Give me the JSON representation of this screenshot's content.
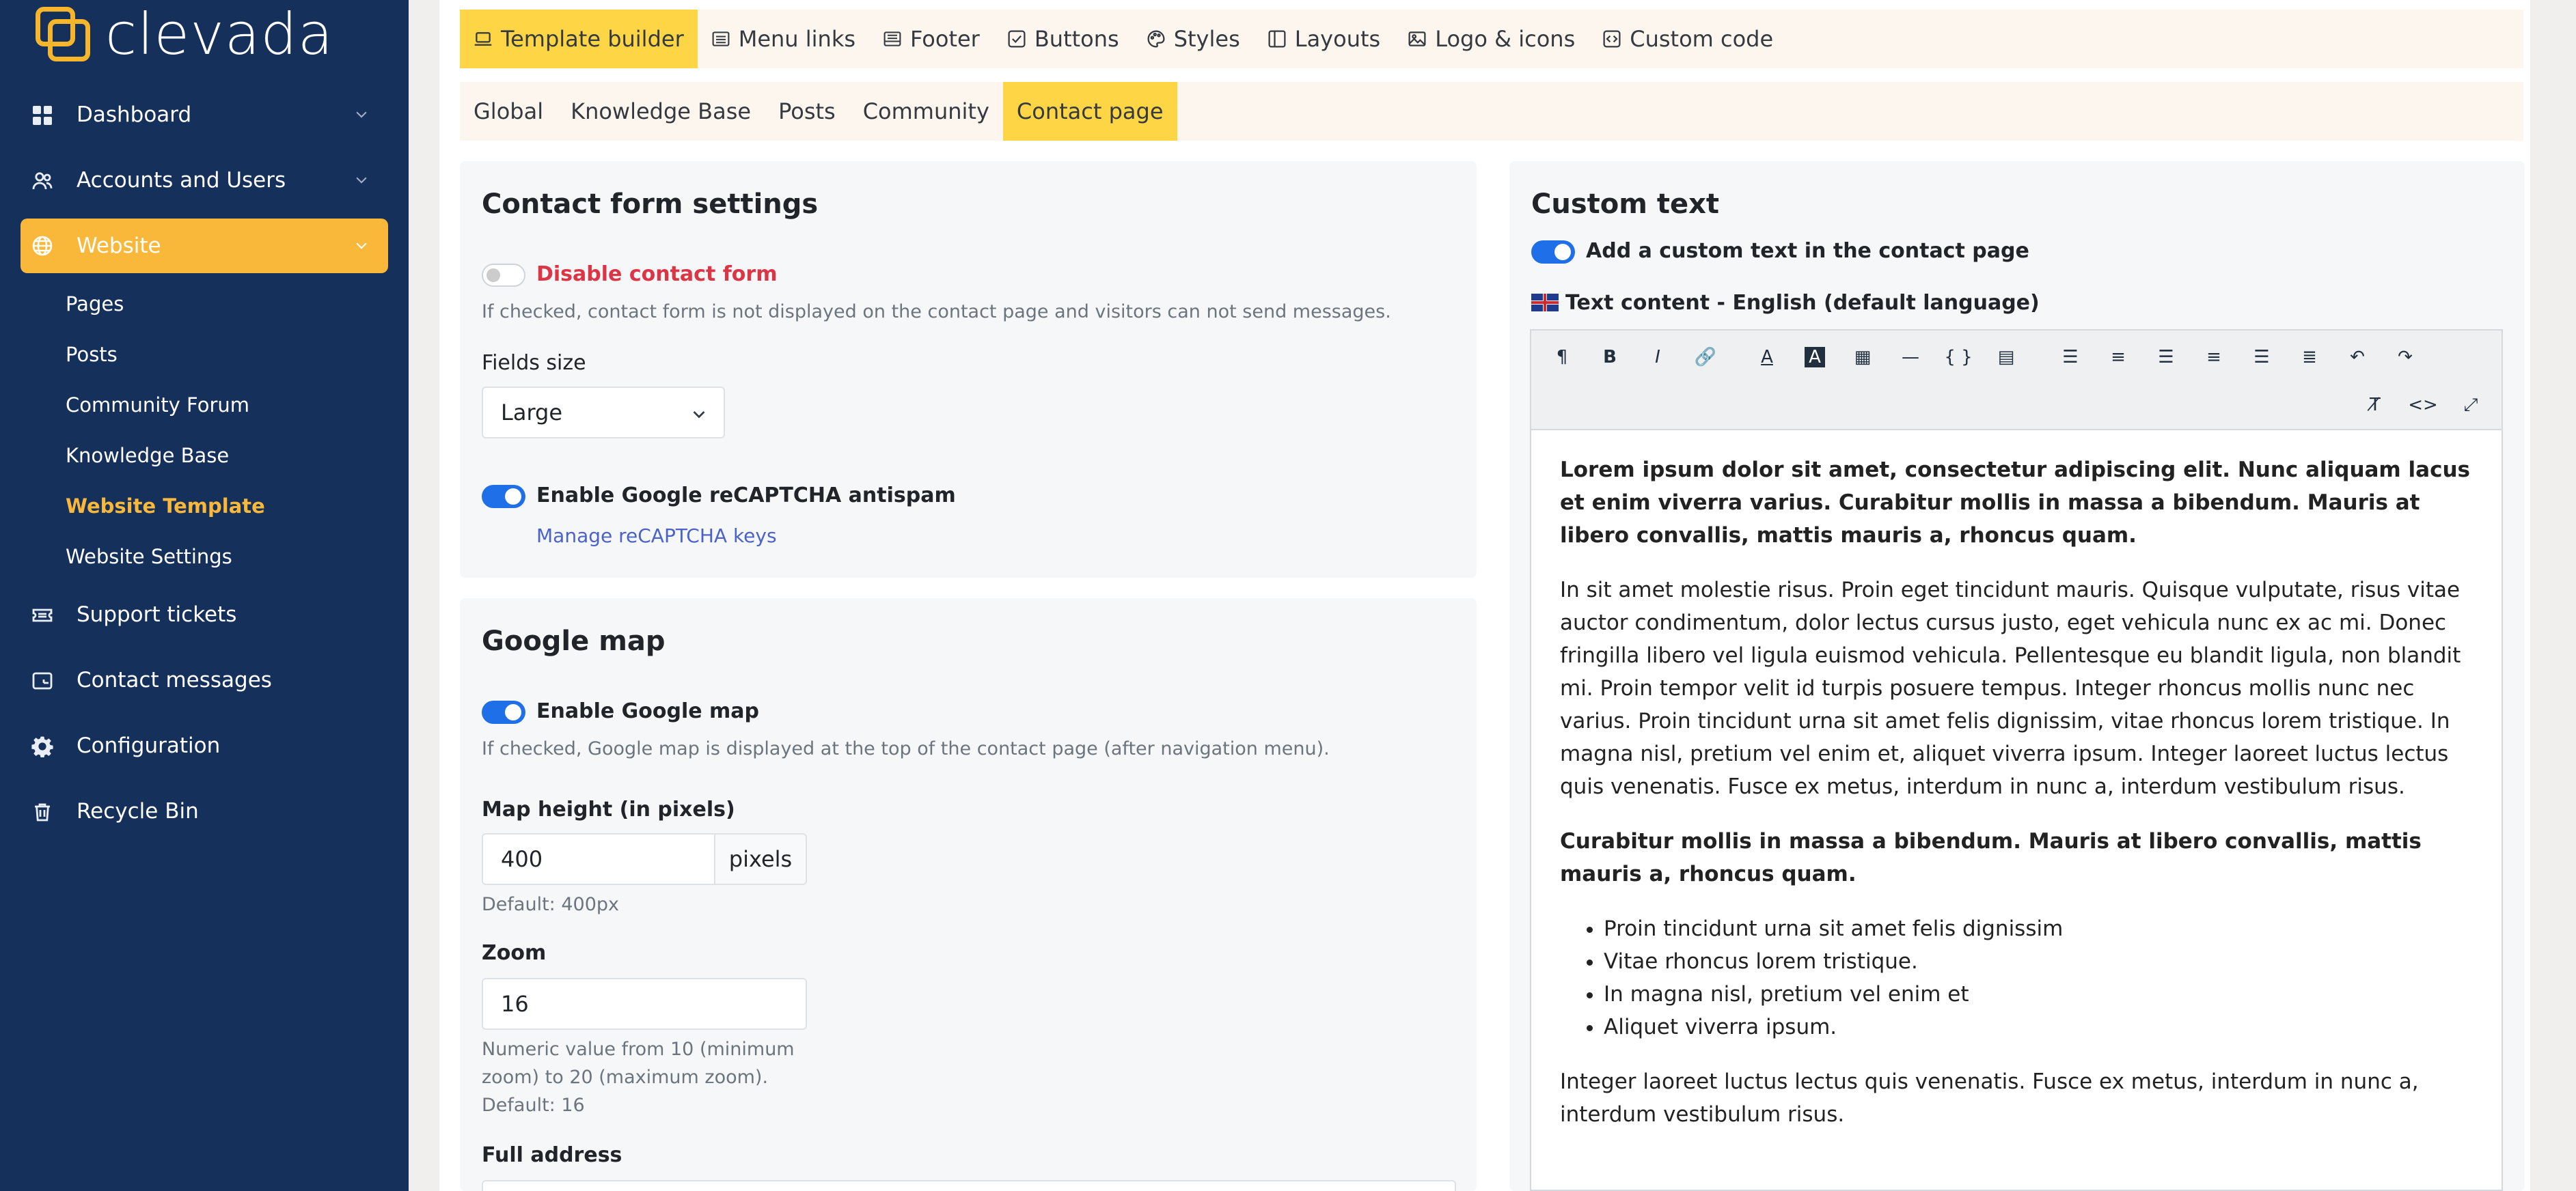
{
  "brand": {
    "name": "clevada",
    "accent": "#f9b839",
    "sidebar_bg": "#15305a"
  },
  "sidebar": {
    "items": [
      {
        "label": "Dashboard",
        "icon": "grid-icon"
      },
      {
        "label": "Accounts and Users",
        "icon": "users-icon"
      },
      {
        "label": "Website",
        "icon": "globe-icon"
      },
      {
        "label": "Support tickets",
        "icon": "ticket-icon"
      },
      {
        "label": "Contact messages",
        "icon": "inbox-icon"
      },
      {
        "label": "Configuration",
        "icon": "gear-icon"
      },
      {
        "label": "Recycle Bin",
        "icon": "trash-icon"
      }
    ],
    "website_sub": [
      "Pages",
      "Posts",
      "Community Forum",
      "Knowledge Base",
      "Website Template",
      "Website Settings"
    ]
  },
  "tabs": [
    "Template builder",
    "Menu links",
    "Footer",
    "Buttons",
    "Styles",
    "Layouts",
    "Logo & icons",
    "Custom code"
  ],
  "subtabs": [
    "Global",
    "Knowledge Base",
    "Posts",
    "Community",
    "Contact page"
  ],
  "contact_form": {
    "title": "Contact form settings",
    "disable_label": "Disable contact form",
    "disable_help": "If checked, contact form is not displayed on the contact page and visitors can not send messages.",
    "fields_size_label": "Fields size",
    "fields_size_value": "Large",
    "recaptcha_label": "Enable Google reCAPTCHA antispam",
    "recaptcha_link": "Manage reCAPTCHA keys"
  },
  "google_map": {
    "title": "Google map",
    "enable_label": "Enable Google map",
    "enable_help": "If checked, Google map is displayed at the top of the contact page (after navigation menu).",
    "height_label": "Map height (in pixels)",
    "height_value": "400",
    "height_unit": "pixels",
    "height_default": "Default: 400px",
    "zoom_label": "Zoom",
    "zoom_value": "16",
    "zoom_help_1": "Numeric value from 10 (minimum",
    "zoom_help_2": "zoom) to 20 (maximum zoom).",
    "zoom_help_3": "Default: 16",
    "address_label": "Full address"
  },
  "custom_text": {
    "title": "Custom text",
    "toggle_label": "Add a custom text in the contact page",
    "content_label": "Text content - English (default language)",
    "p1": "Lorem ipsum dolor sit amet, consectetur adipiscing elit. Nunc aliquam lacus et enim viverra varius. Curabitur mollis in massa a bibendum. Mauris at libero convallis, mattis mauris a, rhoncus quam.",
    "p2": "In sit amet molestie risus. Proin eget tincidunt mauris. Quisque vulputate, risus vitae auctor condimentum, dolor lectus cursus justo, eget vehicula nunc ex ac mi. Donec fringilla libero vel ligula euismod vehicula. Pellentesque eu blandit ligula, non blandit mi. Proin tempor velit id turpis posuere tempus. Integer rhoncus mollis nunc nec varius. Proin tincidunt urna sit amet felis dignissim, vitae rhoncus lorem tristique. In magna nisl, pretium vel enim et, aliquet viverra ipsum. Integer laoreet luctus lectus quis venenatis. Fusce ex metus, interdum in nunc a, interdum vestibulum risus.",
    "p3": "Curabitur mollis in massa a bibendum. Mauris at libero convallis, mattis mauris a, rhoncus quam.",
    "list": [
      "Proin tincidunt urna sit amet felis dignissim",
      "Vitae rhoncus lorem tristique.",
      "In magna nisl, pretium vel enim et",
      "Aliquet viverra ipsum."
    ],
    "p4": "Integer laoreet luctus lectus quis venenatis. Fusce ex metus, interdum in nunc a, interdum vestibulum risus."
  }
}
